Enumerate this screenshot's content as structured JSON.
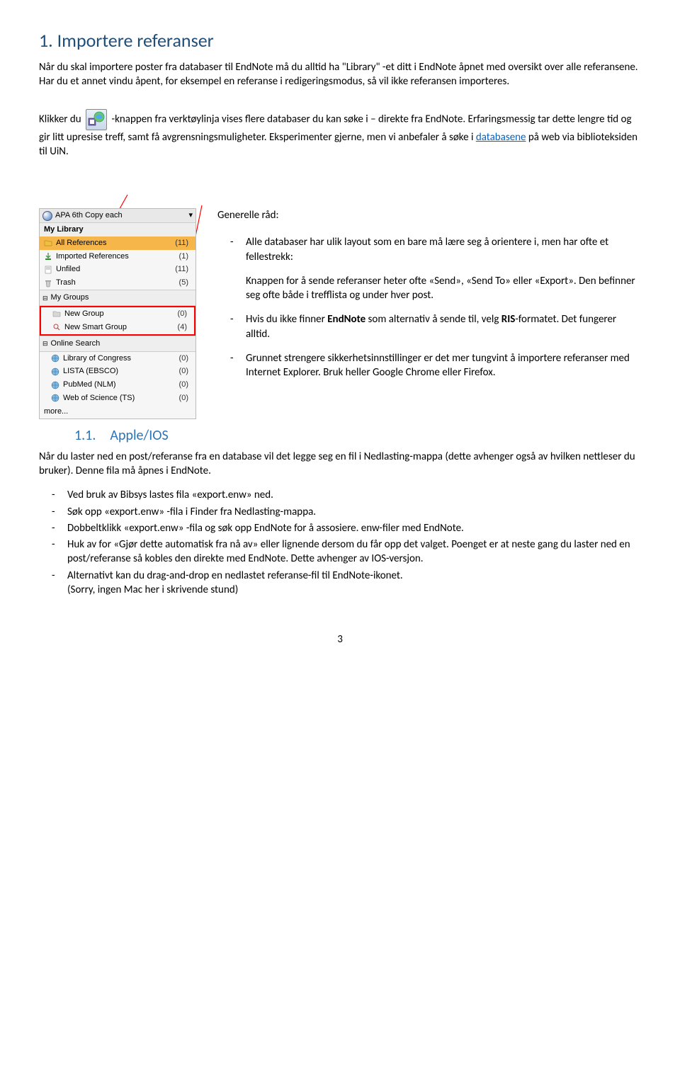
{
  "heading1": "1. Importere referanser",
  "para1": "Når du skal importere poster fra databaser til EndNote må du alltid ha \"Library\" -et ditt i EndNote åpnet med oversikt over alle referansene. Har du et annet vindu åpent, for eksempel en referanse i redigeringsmodus, så vil ikke referansen importeres.",
  "para2a": "Klikker du ",
  "para2b": " -knappen fra verktøylinja vises flere databaser du kan søke i – direkte fra EndNote. Erfaringsmessig tar dette lengre tid og gir litt upresise treff, samt få avgrensningsmuligheter. Eksperimenter gjerne, men vi anbefaler å søke i ",
  "para2_link": "databasene",
  "para2c": " på web via biblioteksiden til UiN.",
  "sidebar": {
    "top_label": "APA 6th Copy each",
    "my_library": "My Library",
    "items": [
      {
        "icon": "folder",
        "label": "All References",
        "n": "(11)",
        "sel": true
      },
      {
        "icon": "import",
        "label": "Imported References",
        "n": "(1)"
      },
      {
        "icon": "unfiled",
        "label": "Unfiled",
        "n": "(11)"
      },
      {
        "icon": "trash",
        "label": "Trash",
        "n": "(5)"
      }
    ],
    "my_groups": "My Groups",
    "groups": [
      {
        "icon": "folder2",
        "label": "New Group",
        "n": "(0)"
      },
      {
        "icon": "smart",
        "label": "New Smart Group",
        "n": "(4)"
      }
    ],
    "online_search": "Online Search",
    "online": [
      {
        "label": "Library of Congress",
        "n": "(0)"
      },
      {
        "label": "LISTA (EBSCO)",
        "n": "(0)"
      },
      {
        "label": "PubMed (NLM)",
        "n": "(0)"
      },
      {
        "label": "Web of Science (TS)",
        "n": "(0)"
      }
    ],
    "more": "more..."
  },
  "right": {
    "general": "Generelle råd:",
    "b1a": "Alle databaser har ulik layout som en bare må lære seg å orientere i, men har ofte et fellestrekk:",
    "b1b": "Knappen for å sende referanser heter ofte «Send», «Send To» eller «Export». Den befinner seg ofte både i trefflista og under hver post.",
    "b2a": "Hvis du ikke finner ",
    "b2b": "EndNote",
    "b2c": " som alternativ å sende til, velg ",
    "b2d": "RIS",
    "b2e": "-formatet. Det fungerer alltid.",
    "b3": "Grunnet strengere sikkerhetsinnstillinger er det mer tungvint å importere referanser med Internet Explorer. Bruk heller Google Chrome eller Firefox."
  },
  "apple_h": "1.1. Apple/IOS",
  "apple_p": "Når du laster ned en post/referanse fra en database vil det legge seg en fil i Nedlasting-mappa (dette avhenger også av hvilken nettleser du bruker). Denne fila må åpnes i EndNote.",
  "apple_list": [
    "Ved bruk av Bibsys lastes fila «export.enw» ned.",
    "Søk opp «export.enw» -fila i Finder fra Nedlasting-mappa.",
    "Dobbeltklikk «export.enw» -fila og søk opp EndNote for å assosiere. enw-filer med EndNote.",
    "Huk av for «Gjør dette automatisk fra nå av» eller lignende dersom du får opp det valget. Poenget er at neste gang du laster ned en post/referanse så kobles den direkte med EndNote. Dette avhenger av IOS-versjon.",
    "Alternativt kan du drag-and-drop en nedlastet referanse-fil til EndNote-ikonet.\n(Sorry, ingen Mac her i skrivende stund)"
  ],
  "page_number": "3"
}
